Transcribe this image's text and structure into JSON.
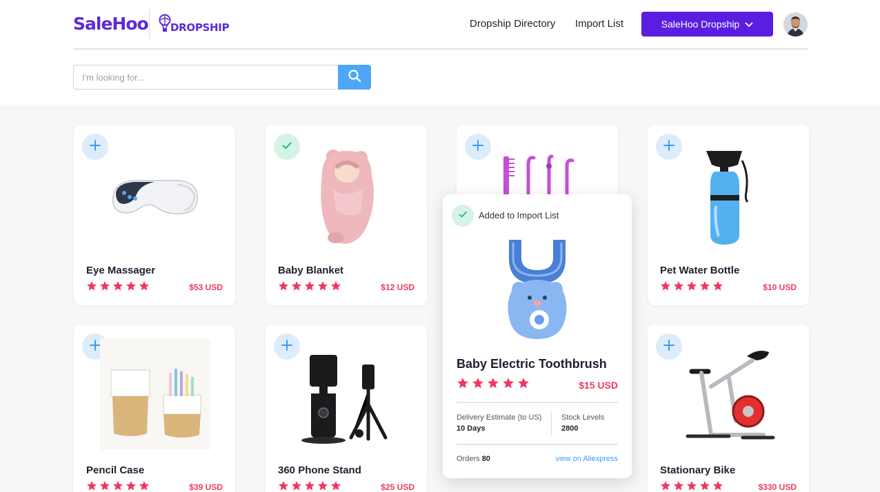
{
  "brand": {
    "name": "SaleHoo",
    "sub": "DROPSHIP"
  },
  "nav": {
    "directory": "Dropship Directory",
    "import_list": "Import List",
    "account_button": "SaleHoo Dropship"
  },
  "search": {
    "placeholder": "I'm looking for..."
  },
  "colors": {
    "brand": "#5a1ee0",
    "price": "#f0385e",
    "star": "#f0385e",
    "search": "#4ea6f6",
    "link": "#3b9bf5"
  },
  "products": [
    {
      "name": "Eye Massager",
      "price": "$53 USD",
      "rating": 5,
      "status": "add",
      "icon": "eye-massager-image"
    },
    {
      "name": "Baby Blanket",
      "price": "$12 USD",
      "rating": 5,
      "status": "added",
      "icon": "baby-blanket-image"
    },
    {
      "name": "",
      "price": "",
      "rating": 0,
      "status": "add",
      "icon": "toothbrush-heads-image"
    },
    {
      "name": "Pet Water Bottle",
      "price": "$10 USD",
      "rating": 5,
      "status": "add",
      "icon": "pet-water-bottle-image"
    },
    {
      "name": "Pencil Case",
      "price": "$39 USD",
      "rating": 5,
      "status": "add",
      "icon": "pencil-case-image"
    },
    {
      "name": "360 Phone Stand",
      "price": "$25 USD",
      "rating": 5,
      "status": "add",
      "icon": "phone-stand-image"
    },
    {
      "name": "Stationary Bike",
      "price": "$330 USD",
      "rating": 5,
      "status": "add",
      "icon": "stationary-bike-image"
    }
  ],
  "popup": {
    "added_label": "Added to Import List",
    "name": "Baby Electric Toothbrush",
    "price": "$15 USD",
    "rating": 5,
    "delivery_label": "Delivery Estimate (to US)",
    "delivery_value": "10 Days",
    "stock_label": "Stock Levels",
    "stock_value": "2800",
    "orders_label": "Orders",
    "orders_value": "80",
    "link_label": "view on Aliexpress"
  }
}
